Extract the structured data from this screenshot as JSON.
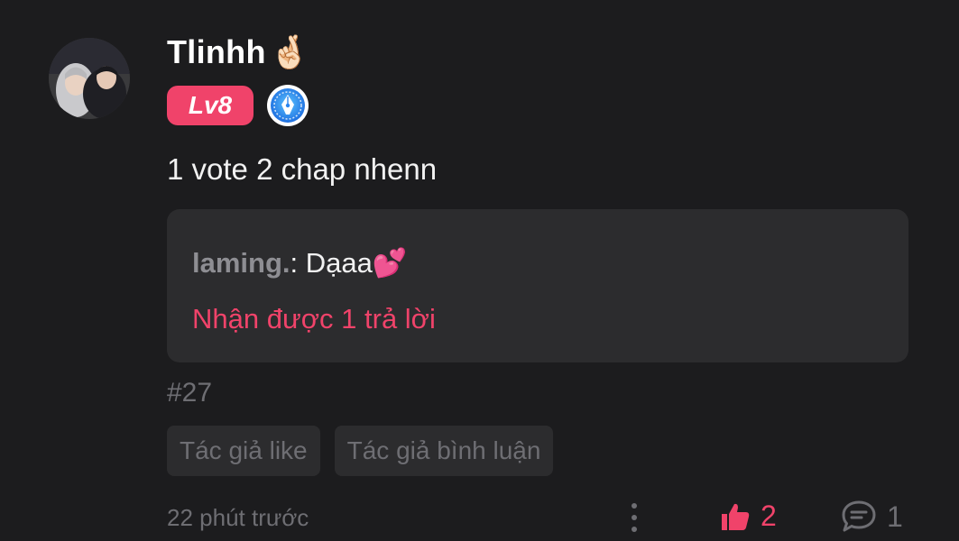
{
  "user": {
    "name": "Tlinhh",
    "name_emoji": "🤞🏻",
    "level": "Lv8",
    "avatar_icon": "avatar-photo",
    "badge_icon": "writer-pen-badge-icon"
  },
  "comment": {
    "text": "1 vote 2 chap nhenn",
    "id": "#27",
    "timestamp": "22 phút trước"
  },
  "reply_preview": {
    "author": "laming.",
    "separator": ": ",
    "text": "Dạaa💕",
    "replies_label": "Nhận được 1 trả lời"
  },
  "tags": [
    "Tác giả like",
    "Tác giả bình luận"
  ],
  "actions": {
    "like_count": "2",
    "reply_count": "1",
    "like_icon": "thumbs-up-icon",
    "reply_icon": "comment-bubble-icon",
    "more_icon": "more-vertical-icon"
  },
  "colors": {
    "background": "#1c1c1e",
    "accent": "#f0436a",
    "muted": "#6e6e73",
    "card": "#2c2c2e"
  }
}
